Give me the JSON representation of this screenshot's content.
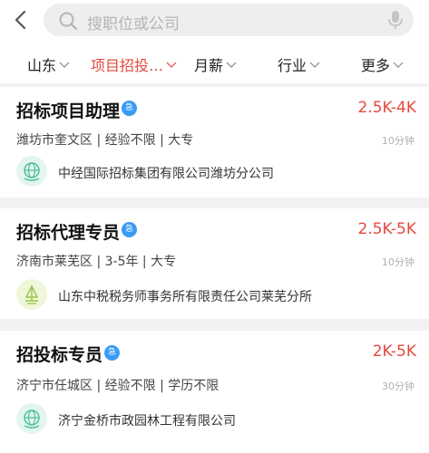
{
  "search": {
    "placeholder": "搜职位或公司"
  },
  "filters": [
    {
      "label": "山东",
      "active": false
    },
    {
      "label": "项目招投…",
      "active": true
    },
    {
      "label": "月薪",
      "active": false
    },
    {
      "label": "行业",
      "active": false
    },
    {
      "label": "更多",
      "active": false
    }
  ],
  "jobs": [
    {
      "title": "招标项目助理",
      "badge": "急",
      "salary": "2.5K-4K",
      "meta": "潍坊市奎文区 | 经验不限 | 大专",
      "time": "10分钟",
      "company": "中经国际招标集团有限公司潍坊分公司",
      "logo_icon": "globe-logo-icon"
    },
    {
      "title": "招标代理专员",
      "badge": "急",
      "salary": "2.5K-5K",
      "meta": "济南市莱芜区 | 3-5年 | 大专",
      "time": "10分钟",
      "company": "山东中税税务师事务所有限责任公司莱芜分所",
      "logo_icon": "scale-logo-icon"
    },
    {
      "title": "招投标专员",
      "badge": "急",
      "salary": "2K-5K",
      "meta": "济宁市任城区 | 经验不限 | 学历不限",
      "time": "30分钟",
      "company": "济宁金桥市政园林工程有限公司",
      "logo_icon": "globe-logo-icon"
    }
  ],
  "colors": {
    "accent": "#e5493d",
    "badge": "#3a9bf4",
    "logo_green_bg": "#e3f5ee",
    "logo_green": "#4cbf9a",
    "logo_yellow_bg": "#eef7d9",
    "logo_yellow": "#9bc24a"
  }
}
